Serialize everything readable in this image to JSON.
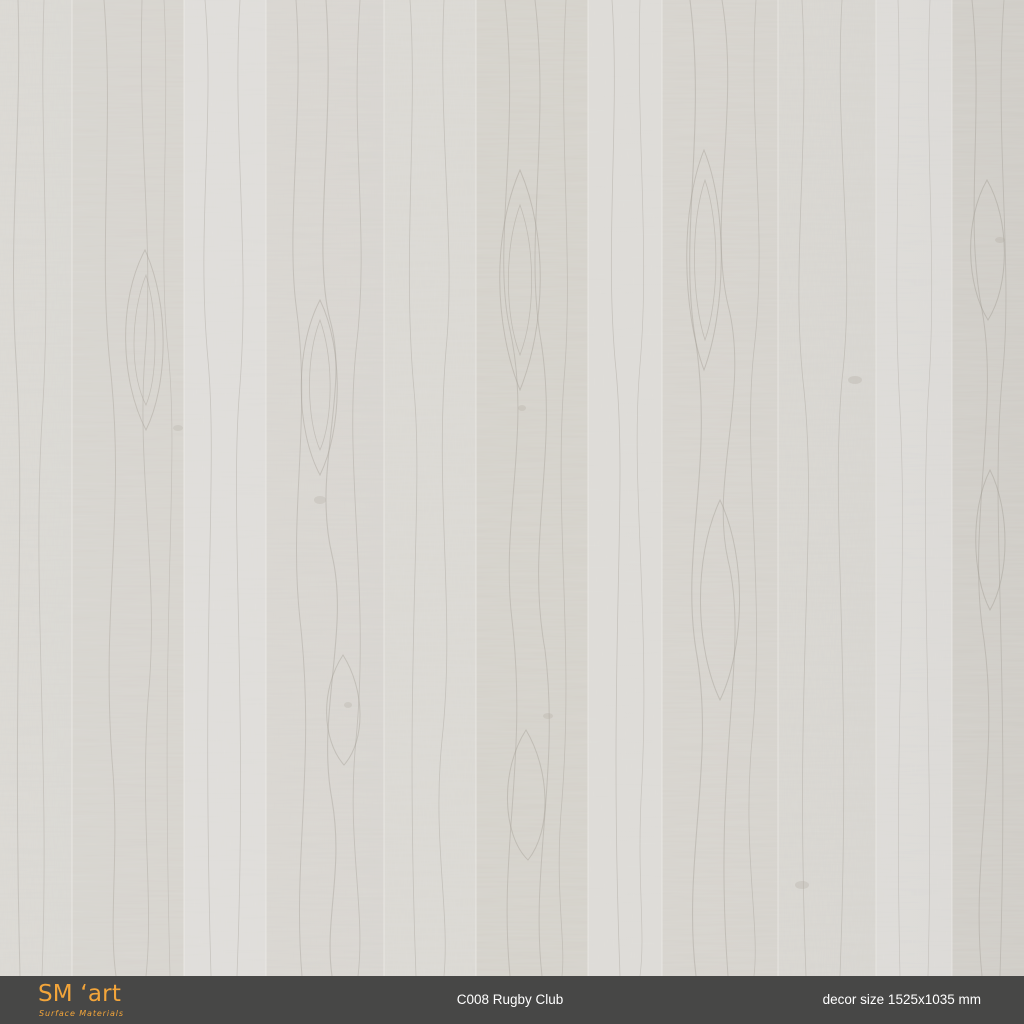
{
  "texture": {
    "name": "light-grey-oak-wood-texture",
    "colors": {
      "base": "#d9d7d2",
      "light": "#e8e6e1",
      "mid": "#cfcac2",
      "dark_grain": "#a9a39a",
      "seam": "#f0eeea"
    }
  },
  "footer": {
    "logo_main": "SM ‘art",
    "logo_sub": "Surface Materials",
    "decor_name": "C008 Rugby Club",
    "decor_size": "decor size 1525x1035 mm",
    "background_color": "#474746",
    "logo_color": "#f3a53a",
    "text_color": "#ffffff"
  }
}
